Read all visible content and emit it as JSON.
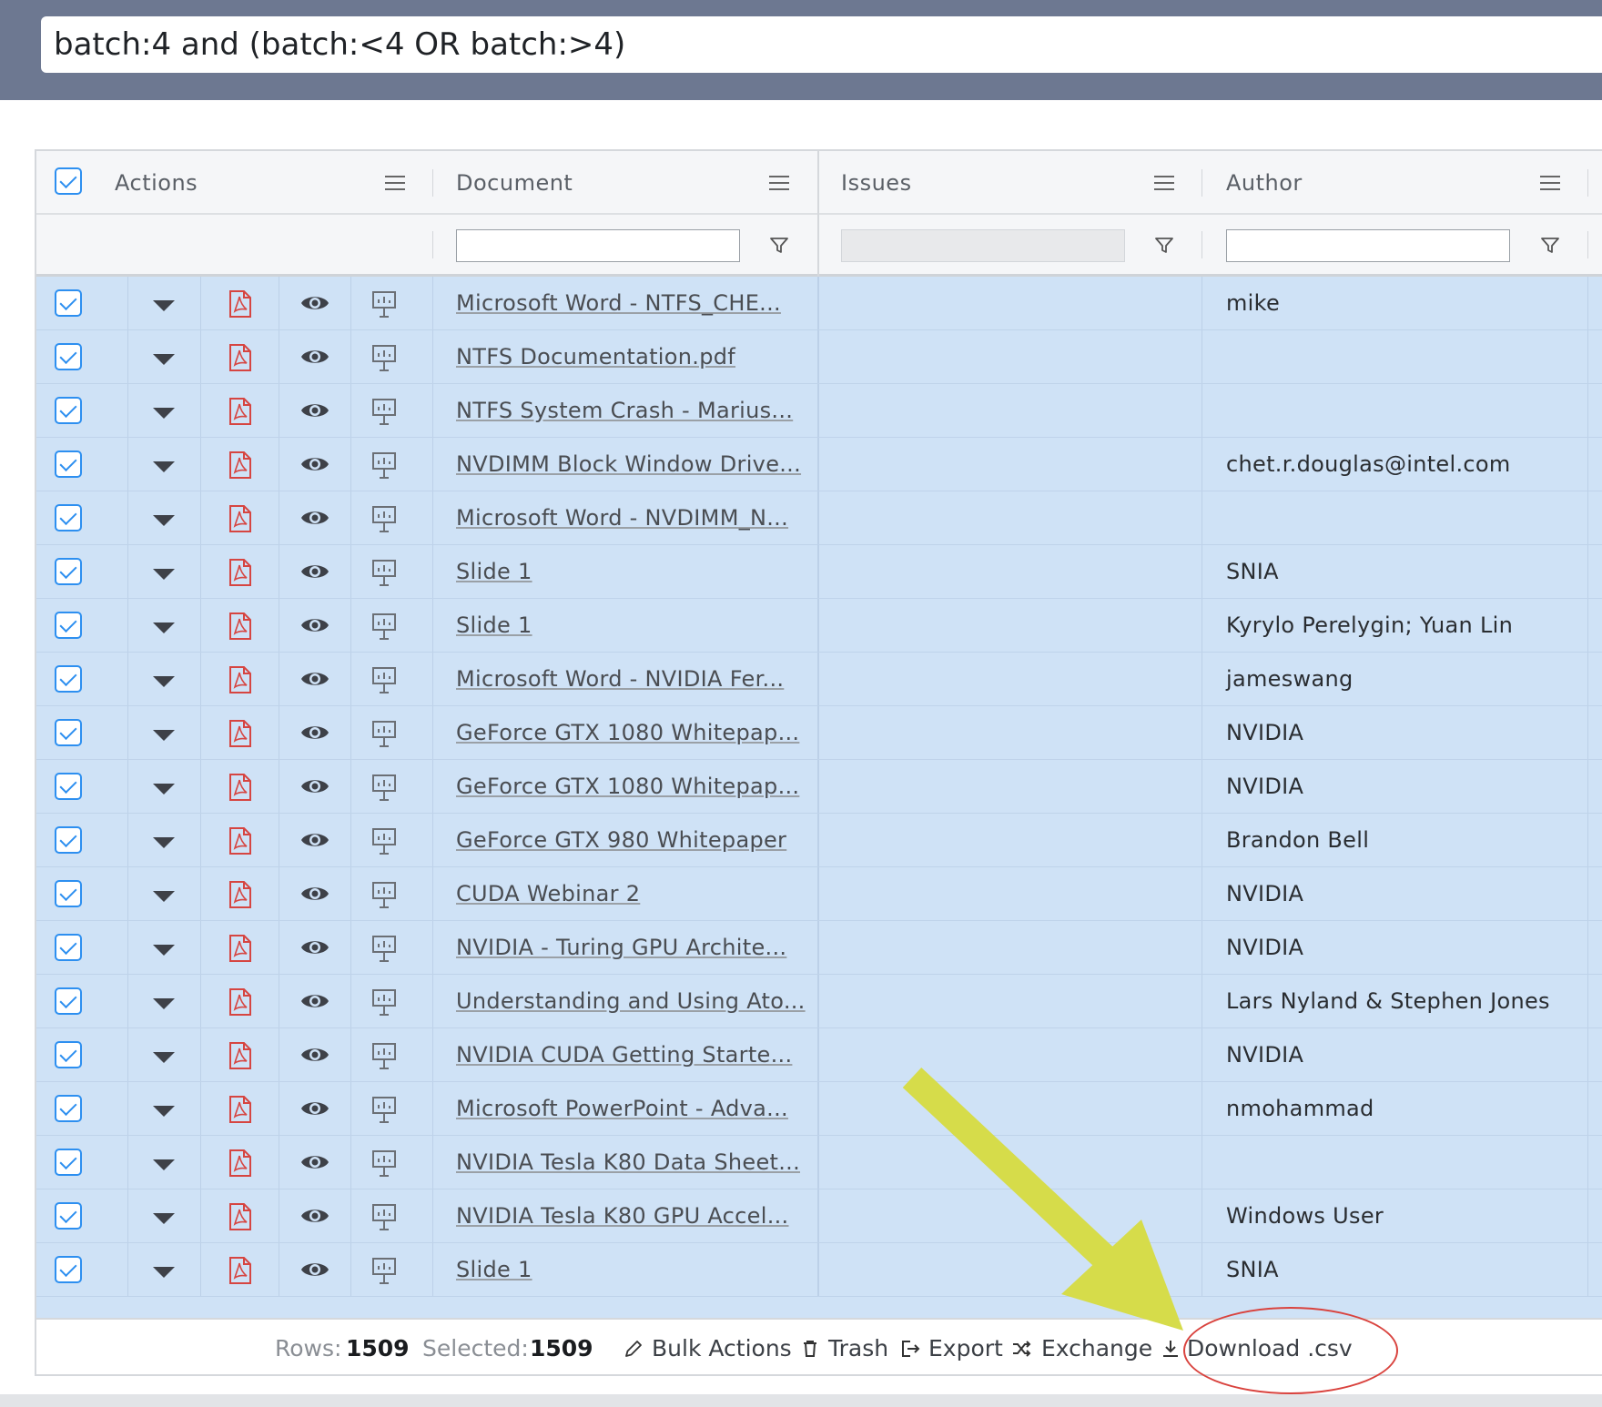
{
  "search": {
    "query": "batch:4 and (batch:<4 OR batch:>4)"
  },
  "columns": {
    "actions": "Actions",
    "document": "Document",
    "issues": "Issues",
    "author": "Author"
  },
  "rows": [
    {
      "document": "Microsoft Word - NTFS_CHE...",
      "author": "mike"
    },
    {
      "document": "NTFS Documentation.pdf",
      "author": ""
    },
    {
      "document": "NTFS System Crash - Marius...",
      "author": ""
    },
    {
      "document": "NVDIMM Block Window Drive...",
      "author": "chet.r.douglas@intel.com"
    },
    {
      "document": "Microsoft Word - NVDIMM_N...",
      "author": ""
    },
    {
      "document": "Slide 1",
      "author": "SNIA"
    },
    {
      "document": "Slide 1",
      "author": "Kyrylo Perelygin; Yuan Lin"
    },
    {
      "document": "Microsoft Word - NVIDIA Fer...",
      "author": "jameswang"
    },
    {
      "document": "GeForce GTX 1080 Whitepap...",
      "author": "NVIDIA"
    },
    {
      "document": "GeForce GTX 1080 Whitepap...",
      "author": "NVIDIA"
    },
    {
      "document": "GeForce GTX 980 Whitepaper",
      "author": "Brandon Bell"
    },
    {
      "document": "CUDA Webinar 2",
      "author": "NVIDIA"
    },
    {
      "document": "NVIDIA - Turing GPU Archite...",
      "author": "NVIDIA"
    },
    {
      "document": "Understanding and Using Ato...",
      "author": "Lars Nyland & Stephen Jones"
    },
    {
      "document": "NVIDIA CUDA Getting Starte...",
      "author": "NVIDIA"
    },
    {
      "document": "Microsoft PowerPoint - Adva...",
      "author": "nmohammad"
    },
    {
      "document": "NVIDIA Tesla K80 Data Sheet...",
      "author": ""
    },
    {
      "document": "NVIDIA Tesla K80 GPU Accel...",
      "author": "Windows User"
    },
    {
      "document": "Slide 1",
      "author": "SNIA"
    }
  ],
  "footer": {
    "rows_label": "Rows:",
    "rows_value": "1509",
    "selected_label": "Selected:",
    "selected_value": "1509",
    "bulk_actions": "Bulk Actions",
    "trash": "Trash",
    "export": "Export",
    "exchange": "Exchange",
    "download_csv": "Download .csv"
  },
  "colors": {
    "topbar": "#6d7891",
    "row_selected": "#cfe2f6",
    "checkbox": "#2d8ff0",
    "pdf_icon": "#d64541",
    "annotation_arrow": "#d6dc4a",
    "annotation_circle": "#d9433e"
  },
  "icons": {
    "row_icons": [
      "checkbox-icon",
      "caret-down-icon",
      "pdf-icon",
      "eye-icon",
      "presentation-icon"
    ],
    "header": [
      "menu-icon",
      "filter-icon"
    ],
    "footer": [
      "pencil-icon",
      "trash-icon",
      "export-icon",
      "shuffle-icon",
      "download-icon"
    ]
  }
}
